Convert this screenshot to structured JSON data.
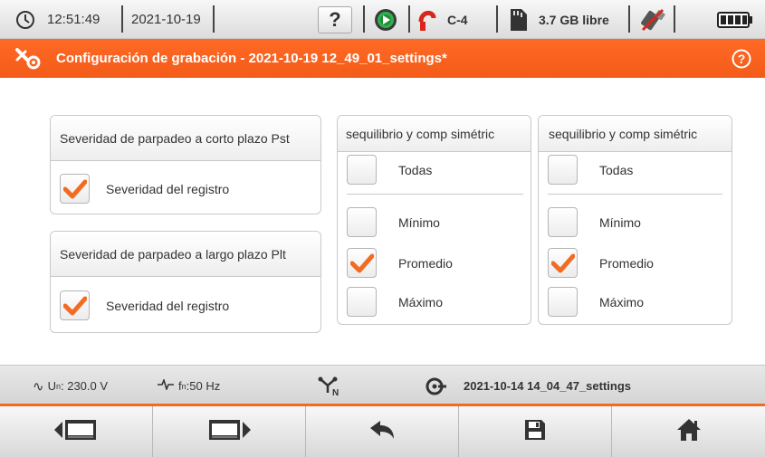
{
  "status": {
    "time": "12:51:49",
    "date": "2021-10-19",
    "help_label": "?",
    "clamp_label": "C-4",
    "storage_label": "3.7 GB libre"
  },
  "titlebar": {
    "title": "Configuración de grabación - 2021-10-19 12_49_01_settings*"
  },
  "flicker": {
    "pst": {
      "header": "Severidad de parpadeo a corto plazo Pst",
      "option": "Severidad del registro",
      "checked": true
    },
    "plt": {
      "header": "Severidad de parpadeo a largo plazo Plt",
      "option": "Severidad del registro",
      "checked": true
    }
  },
  "unbalance_left": {
    "header": "sequilibrio y comp simétric",
    "all": "Todas",
    "items": [
      {
        "label": "Mínimo",
        "checked": false
      },
      {
        "label": "Promedio",
        "checked": true
      },
      {
        "label": "Máximo",
        "checked": false
      }
    ]
  },
  "unbalance_right": {
    "header": "sequilibrio y comp simétric",
    "all": "Todas",
    "items": [
      {
        "label": "Mínimo",
        "checked": false
      },
      {
        "label": "Promedio",
        "checked": true
      },
      {
        "label": "Máximo",
        "checked": false
      }
    ]
  },
  "info": {
    "un_label": "U",
    "un_sub": "n",
    "un_value": ": 230.0 V",
    "fn_label": "f",
    "fn_sub": "n",
    "fn_value": ":50 Hz",
    "config_name": "2021-10-14 14_04_47_settings"
  },
  "colors": {
    "accent": "#f36b21",
    "check": "#f36b21"
  },
  "icons": {
    "clock": "clock-icon",
    "help": "help-icon",
    "record": "record-icon",
    "clamp": "clamp-icon",
    "sdcard": "sdcard-icon",
    "usb": "usb-icon",
    "battery": "battery-icon",
    "settings": "tools-icon",
    "help_circle": "help-circle-icon",
    "wave": "sine-wave-icon",
    "freq": "frequency-icon",
    "network": "network-topology-icon",
    "clamp_info": "clamp-info-icon",
    "prev": "screen-prev-icon",
    "next": "screen-next-icon",
    "back": "back-arrow-icon",
    "save": "save-icon",
    "home": "home-icon"
  }
}
